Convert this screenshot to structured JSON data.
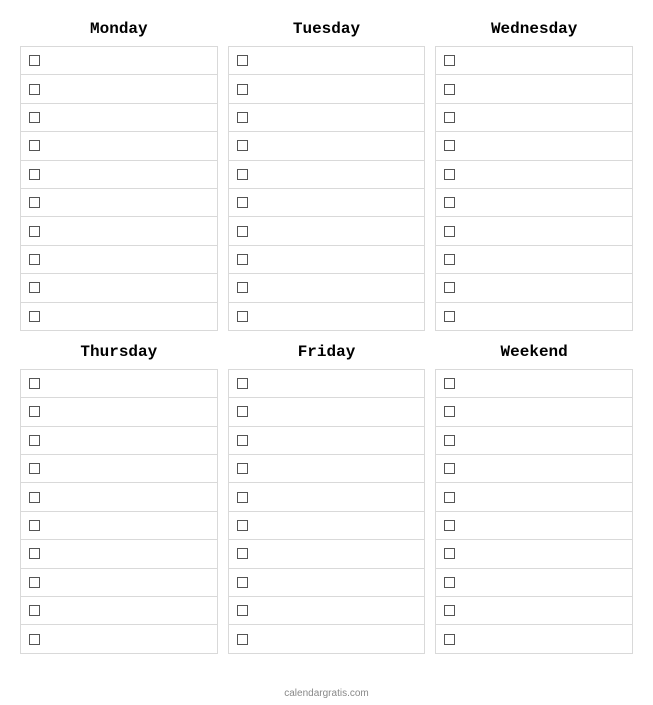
{
  "days": [
    {
      "title": "Monday",
      "tasks": [
        "",
        "",
        "",
        "",
        "",
        "",
        "",
        "",
        "",
        ""
      ]
    },
    {
      "title": "Tuesday",
      "tasks": [
        "",
        "",
        "",
        "",
        "",
        "",
        "",
        "",
        "",
        ""
      ]
    },
    {
      "title": "Wednesday",
      "tasks": [
        "",
        "",
        "",
        "",
        "",
        "",
        "",
        "",
        "",
        ""
      ]
    },
    {
      "title": "Thursday",
      "tasks": [
        "",
        "",
        "",
        "",
        "",
        "",
        "",
        "",
        "",
        ""
      ]
    },
    {
      "title": "Friday",
      "tasks": [
        "",
        "",
        "",
        "",
        "",
        "",
        "",
        "",
        "",
        ""
      ]
    },
    {
      "title": "Weekend",
      "tasks": [
        "",
        "",
        "",
        "",
        "",
        "",
        "",
        "",
        "",
        ""
      ]
    }
  ],
  "footer": "calendargratis.com"
}
